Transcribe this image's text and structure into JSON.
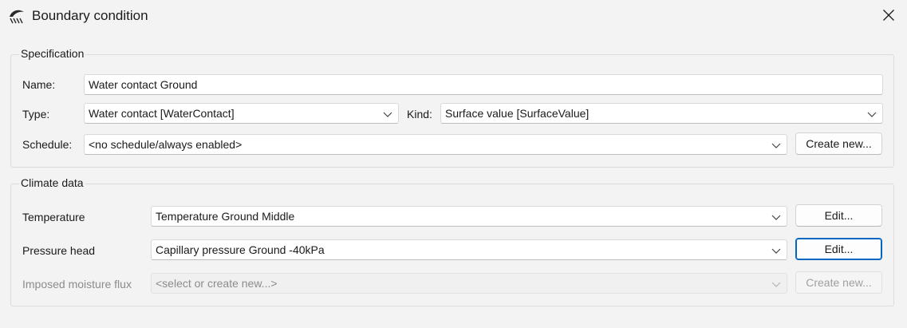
{
  "window": {
    "title": "Boundary condition",
    "app_icon": "boundary-condition-icon",
    "close_icon": "close-icon"
  },
  "specification": {
    "group_title": "Specification",
    "name_label": "Name:",
    "name_value": "Water contact Ground",
    "type_label": "Type:",
    "type_value": "Water contact [WaterContact]",
    "kind_label": "Kind:",
    "kind_value": "Surface value [SurfaceValue]",
    "schedule_label": "Schedule:",
    "schedule_value": "<no schedule/always enabled>",
    "create_new_label": "Create new..."
  },
  "climate_data": {
    "group_title": "Climate data",
    "temperature_label": "Temperature",
    "temperature_value": "Temperature Ground Middle",
    "temperature_edit_label": "Edit...",
    "pressure_label": "Pressure head",
    "pressure_value": "Capillary pressure Ground -40kPa",
    "pressure_edit_label": "Edit...",
    "moisture_label": "Imposed moisture flux",
    "moisture_value": "<select or create new...>",
    "moisture_create_label": "Create new..."
  },
  "colors": {
    "focus_accent": "#0067c0",
    "disabled_text": "#8c8c8c"
  }
}
